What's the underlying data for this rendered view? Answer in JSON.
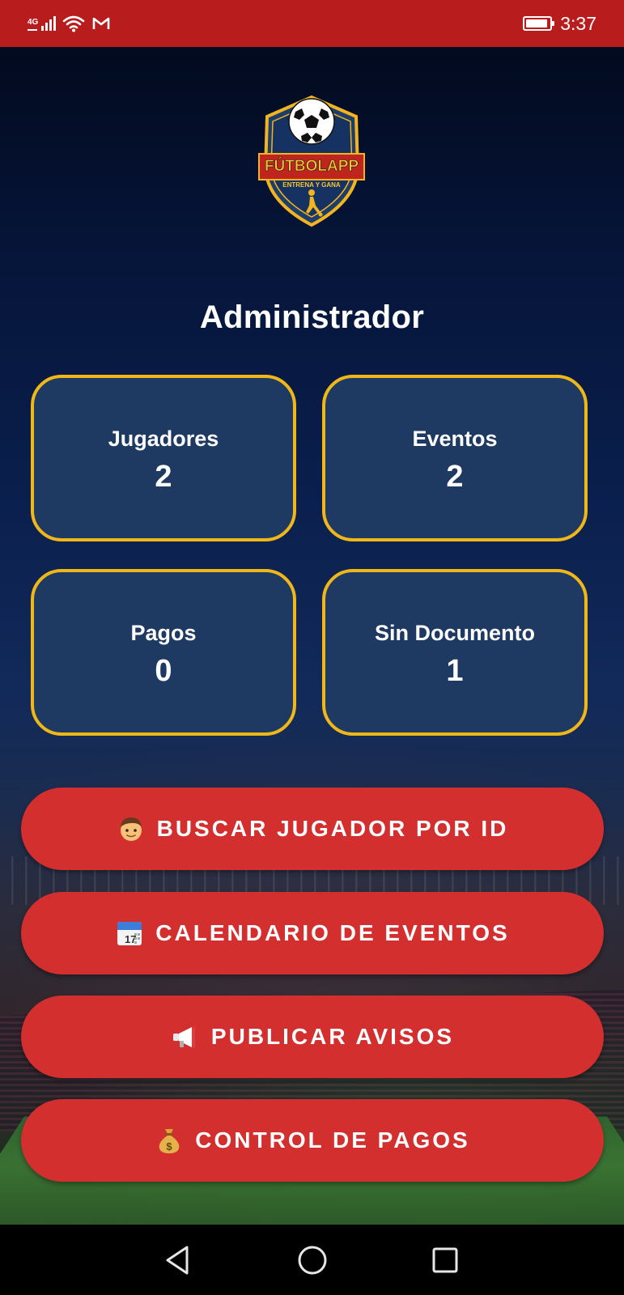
{
  "status_bar": {
    "network_type": "4G",
    "time": "3:37",
    "icons": [
      "signal-icon",
      "wifi-icon",
      "gmail-icon",
      "battery-icon"
    ]
  },
  "logo": {
    "brand": "FÚTBOLAPP",
    "tagline": "ENTRENA Y GANA"
  },
  "page_title": "Administrador",
  "stats": [
    {
      "label": "Jugadores",
      "value": "2"
    },
    {
      "label": "Eventos",
      "value": "2"
    },
    {
      "label": "Pagos",
      "value": "0"
    },
    {
      "label": "Sin Documento",
      "value": "1"
    }
  ],
  "actions": [
    {
      "icon": "boy-icon",
      "label": "BUSCAR JUGADOR POR ID"
    },
    {
      "icon": "calendar-icon",
      "label": "CALENDARIO DE EVENTOS"
    },
    {
      "icon": "megaphone-icon",
      "label": "PUBLICAR AVISOS"
    },
    {
      "icon": "money-bag-icon",
      "label": "CONTROL DE PAGOS"
    }
  ],
  "nav_bar": {
    "buttons": [
      "back-icon",
      "home-icon",
      "recents-icon"
    ]
  },
  "colors": {
    "status_bar": "#b81c1c",
    "card_bg": "#1e3a62",
    "card_border": "#f0b719",
    "button_bg": "#d32f2f"
  }
}
